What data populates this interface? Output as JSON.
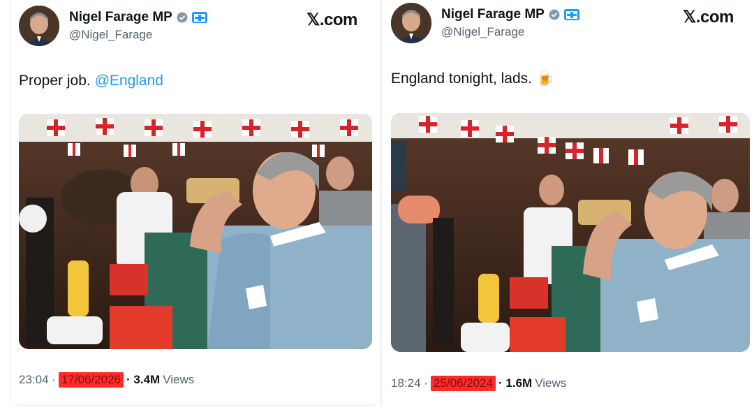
{
  "tweets": [
    {
      "name": "Nigel Farage MP",
      "handle": "@Nigel_Farage",
      "site": "𝕏.com",
      "text": "Proper job. ",
      "mention": "@England",
      "time": "23:04 ·",
      "date": "17/06/2026",
      "views_count": "· 3.4M",
      "views_label": "Views"
    },
    {
      "name": "Nigel Farage MP",
      "handle": "@Nigel_Farage",
      "site": "𝕏.com",
      "text": "England tonight, lads. 🍺",
      "time": "18:24 ·",
      "date": "25/06/2024",
      "views_count": "· 1.6M",
      "views_label": "Views"
    }
  ],
  "colors": {
    "accent": "#1d9bf0",
    "date_highlight": "#ff2a2a"
  },
  "icons": [
    "verified-badge-icon",
    "flag-badge-icon"
  ]
}
